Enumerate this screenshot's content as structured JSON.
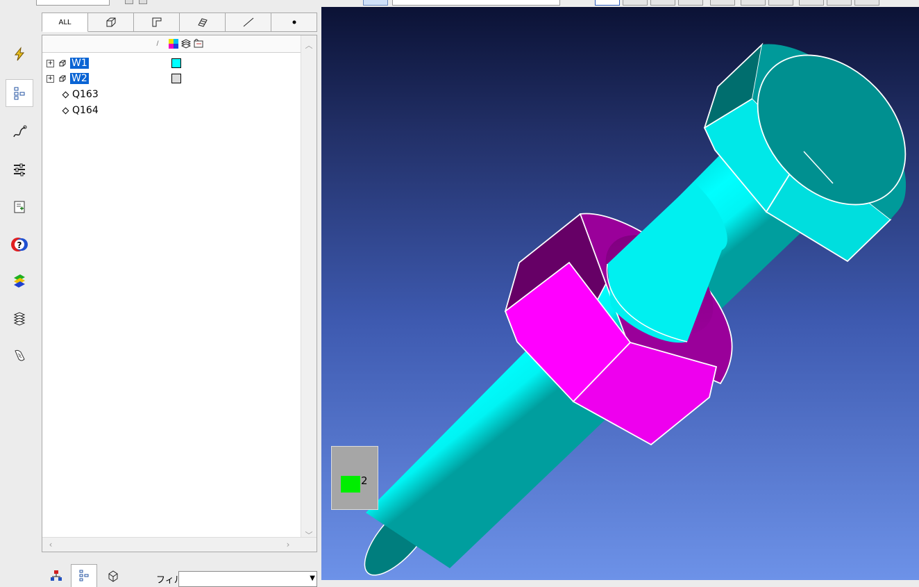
{
  "panel": {
    "tabs": [
      {
        "label": "ALL",
        "icon": "all-text"
      },
      {
        "icon": "solid-icon"
      },
      {
        "icon": "face-icon"
      },
      {
        "icon": "shell-icon"
      },
      {
        "icon": "edge-icon"
      },
      {
        "icon": "vertex-icon"
      }
    ],
    "tree": [
      {
        "label": "W1",
        "color": "#00ffff",
        "selected": true
      },
      {
        "label": "W2",
        "color": "#dcdcdc",
        "selected": true
      },
      {
        "label": "Q163"
      },
      {
        "label": "Q164"
      }
    ],
    "filter_label": "フィルタ",
    "filter_value": ""
  },
  "legend": {
    "count": "2",
    "color": "#00ee00"
  },
  "colors": {
    "bolt": "#00ffff",
    "nut": "#ff00ff",
    "outline": "#ffffff"
  }
}
